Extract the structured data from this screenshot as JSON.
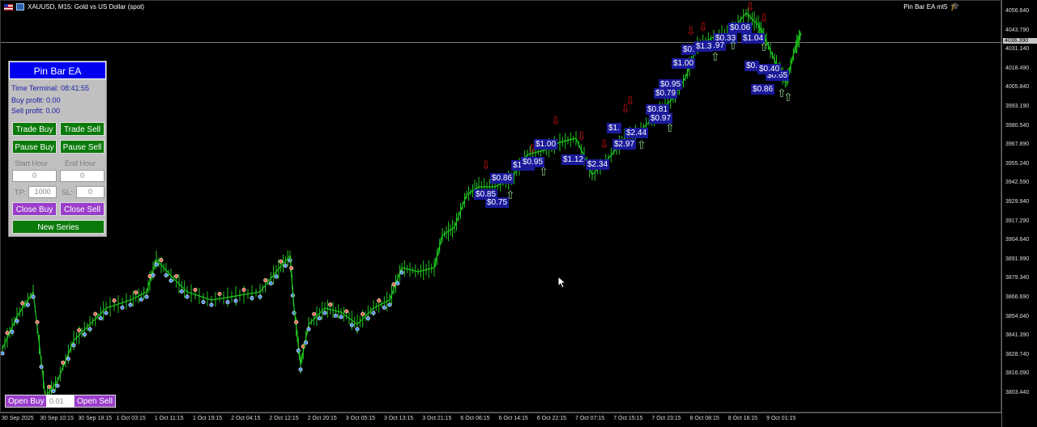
{
  "window": {
    "title": "XAUUSD, M15:  Gold vs US Dollar (spot)",
    "ea_name": "Pin Bar EA mt5"
  },
  "panel": {
    "title": "Pin Bar EA",
    "time_terminal": "Time Terminal:  08:41:55",
    "buy_profit": "Buy profit:  0.00",
    "sell_profit": "Sell profit:  0.00",
    "trade_buy": "Trade Buy",
    "trade_sell": "Trade Sell",
    "pause_buy": "Pause Buy",
    "pause_sell": "Pause Sell",
    "start_hour_label": "Start Hour",
    "end_hour_label": "End Hour",
    "start_hour_value": "0",
    "end_hour_value": "0",
    "tp_label": "TP:",
    "tp_value": "1000",
    "sl_label": "SL:",
    "sl_value": "0",
    "close_buy": "Close Buy",
    "close_sell": "Close Sell",
    "new_series": "New Series"
  },
  "bottom": {
    "open_buy": "Open Buy",
    "lot": "0.01",
    "open_sell": "Open Sell"
  },
  "price_axis": {
    "current": "4036.390",
    "labels": [
      "4056.640",
      "4043.790",
      "4031.140",
      "4018.490",
      "4005.840",
      "3993.190",
      "3980.540",
      "3967.890",
      "3955.240",
      "3942.590",
      "3929.940",
      "3917.290",
      "3904.640",
      "3891.990",
      "3879.340",
      "3866.690",
      "3854.040",
      "3841.390",
      "3828.740",
      "3816.090",
      "3803.440"
    ]
  },
  "time_axis": {
    "labels": [
      "30 Sep 2025",
      "30 Sep 10:15",
      "30 Sep 18:15",
      "1 Oct 03:15",
      "1 Oct 11:15",
      "1 Oct 19:15",
      "2 Oct 04:15",
      "2 Oct 12:15",
      "2 Oct 20:15",
      "3 Oct 05:15",
      "3 Oct 13:15",
      "3 Oct 21:15",
      "6 Oct 06:15",
      "6 Oct 14:15",
      "6 Oct 22:15",
      "7 Oct 07:15",
      "7 Oct 15:15",
      "7 Oct 23:15",
      "8 Oct 08:15",
      "8 Oct 16:15",
      "9 Oct 01:15"
    ]
  },
  "profit_labels": [
    "$0.06",
    "$1.04",
    "$0.33",
    "$2.97",
    "$1.3",
    "$0.",
    "$1.00",
    "$0.",
    "$0.65",
    "$0.40",
    "$0.86",
    "$0.95",
    "$0.79",
    "$0.81",
    "$0.97",
    "$2.44",
    "$2.97",
    "$1.00",
    "$1.12",
    "$2.34",
    "$1.00",
    "$0.95",
    "$0.86",
    "$0.85",
    "$0.75",
    "$1."
  ],
  "colors": {
    "panel_title_bg": "#0000f0",
    "button_green": "#0a7a0a",
    "button_purple": "#9a3ecb",
    "candle": "#1ec81e",
    "label_bg": "#1a1a9a"
  }
}
